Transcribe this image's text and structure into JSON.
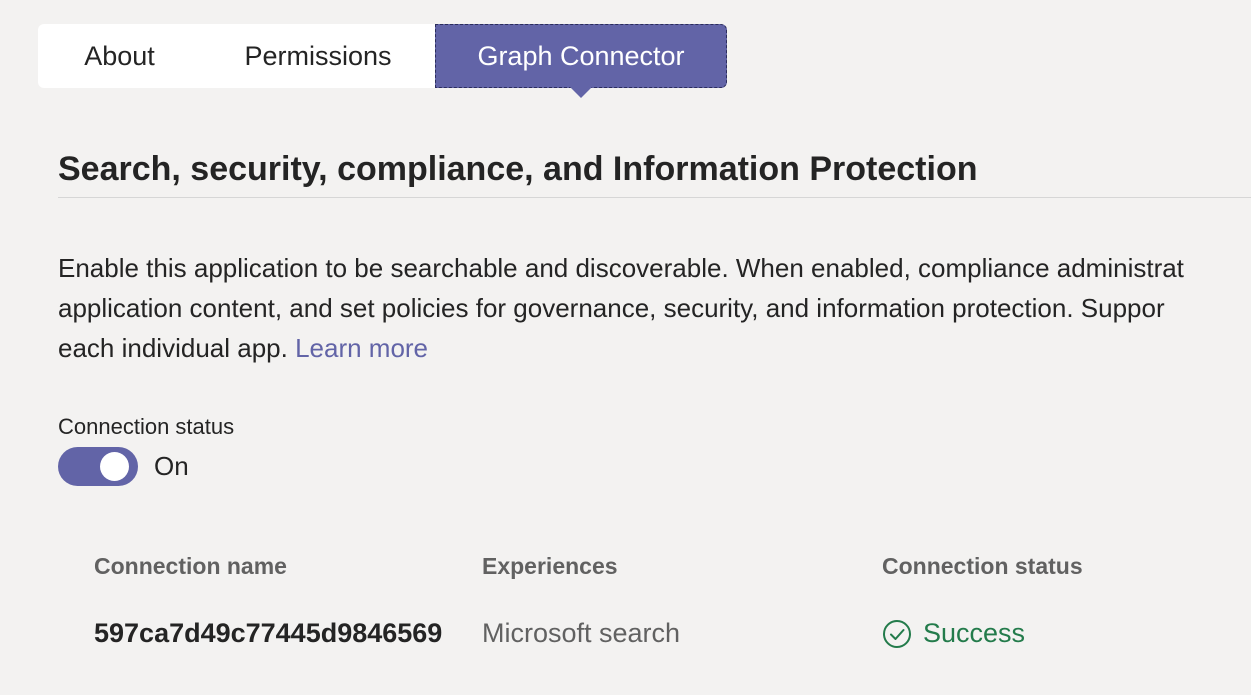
{
  "tabs": [
    {
      "label": "About"
    },
    {
      "label": "Permissions"
    },
    {
      "label": "Graph Connector",
      "selected": true
    }
  ],
  "section": {
    "title": "Search, security, compliance, and Information Protection",
    "description_line1": "Enable this application to be searchable and discoverable. When enabled, compliance administrat",
    "description_line2": "application content, and set policies for governance, security, and information protection. Suppor",
    "description_line3": "each individual app. ",
    "learn_more": "Learn more"
  },
  "connection": {
    "status_label": "Connection status",
    "toggle_state": "On",
    "toggle_on": true
  },
  "table": {
    "headers": [
      "Connection name",
      "Experiences",
      "Connection status"
    ],
    "rows": [
      {
        "name": "597ca7d49c77445d9846569",
        "experience": "Microsoft search",
        "status": "Success",
        "status_icon": "check-circle-icon"
      }
    ]
  },
  "colors": {
    "accent": "#6264a7",
    "success": "#237b4b",
    "background": "#f3f2f1"
  }
}
